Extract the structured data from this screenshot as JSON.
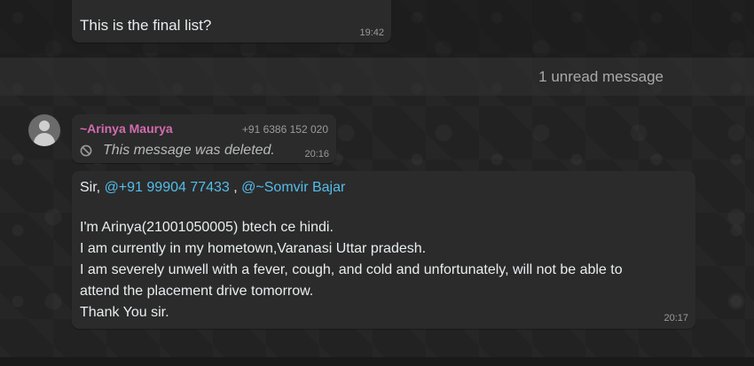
{
  "previous_message": {
    "quoted_text": "",
    "text": "This is the final list?",
    "time": "19:42"
  },
  "unread_divider": {
    "label": "1 unread message"
  },
  "deleted_message": {
    "sender": "~Arinya Maurya",
    "phone": "+91 6386 152 020",
    "text": "This message was deleted.",
    "time": "20:16",
    "icon": "blocked-icon"
  },
  "main_message": {
    "salutation": "Sir, ",
    "mention_1": "@+91 99904 77433",
    "separator": " , ",
    "mention_2": "@~Somvir Bajar",
    "lines": [
      "I'm Arinya(21001050005) btech ce hindi.",
      "I am currently in my hometown,Varanasi Uttar pradesh.",
      "I am severely unwell with a fever, cough, and cold and  unfortunately, will not be able to",
      "attend the placement drive tomorrow.",
      "Thank You sir."
    ],
    "time": "20:17"
  },
  "colors": {
    "sender_name": "#d46bb0",
    "mention": "#53bdeb",
    "bubble": "#2b2b2b",
    "quote_bar": "#a6d13b"
  }
}
